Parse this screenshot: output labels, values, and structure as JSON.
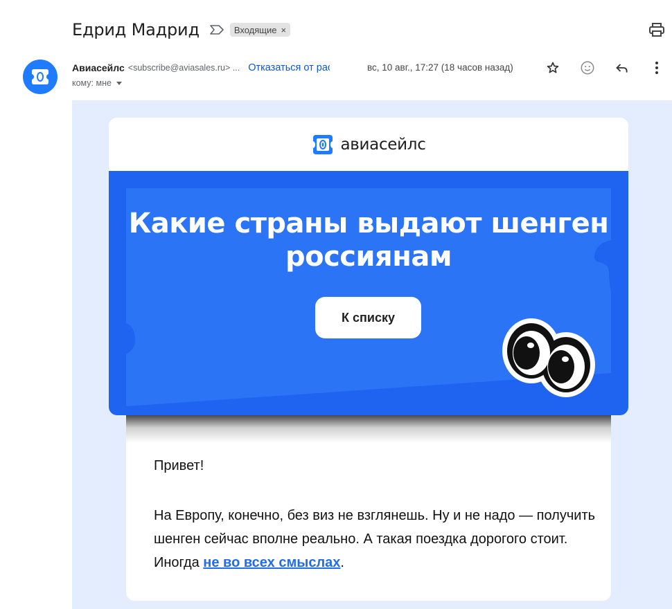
{
  "subject": {
    "title": "Едрид Мадрид",
    "label": "Входящие",
    "label_remove": "×"
  },
  "sender": {
    "name": "Авиасейлс",
    "email": "<subscribe@aviasales.ru> ...",
    "unsubscribe": "Отказаться от рассылки",
    "date": "вс, 10 авг., 17:27 (18 часов назад)",
    "recipient": "кому: мне"
  },
  "email": {
    "logo_text": "авиасейлс",
    "hero_title": "Какие страны выдают шенген россиянам",
    "cta_label": "К списку",
    "greeting": "Привет!",
    "paragraph_text": "На Европу, конечно, без виз не взглянешь. Ну и не надо — получить шенген сейчас вполне реально. А такая поездка дорогого стоит. Иногда ",
    "paragraph_link": "не во всех смыслах",
    "paragraph_end": "."
  },
  "icons": [
    "importance-marker-icon",
    "print-icon",
    "star-icon",
    "emoji-icon",
    "reply-icon",
    "more-vertical-icon",
    "aviasales-logo-icon",
    "eyes-illustration"
  ],
  "colors": {
    "brand_blue": "#1e64f0",
    "ticket_blue": "#2b74f5",
    "link_blue": "#0b57d0",
    "mail_bg": "#e4edfd"
  }
}
